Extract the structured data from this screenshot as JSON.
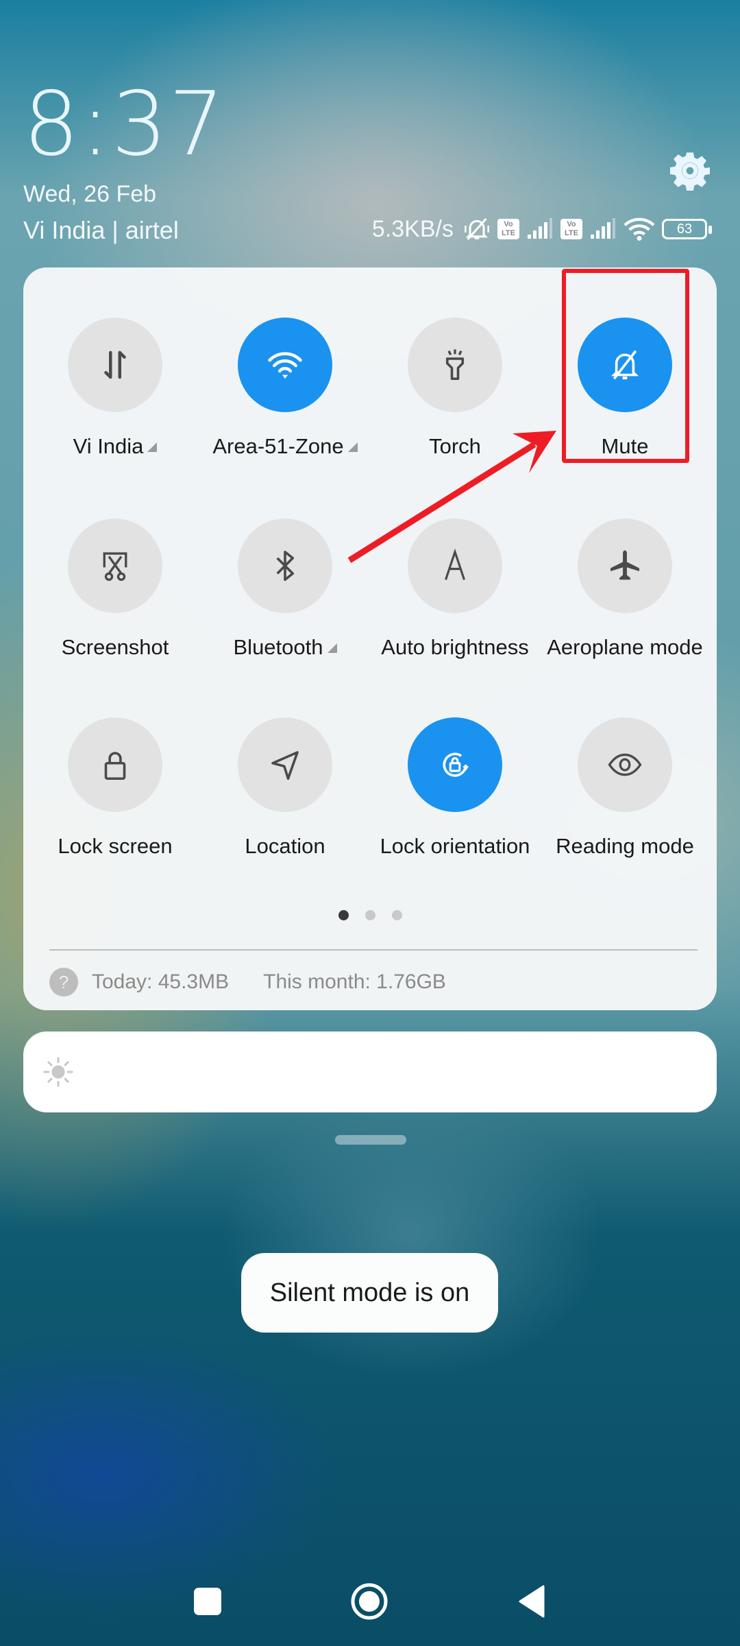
{
  "header": {
    "time": "8:37",
    "date": "Wed, 26 Feb",
    "carrier": "Vi India | airtel",
    "settings_icon": "gear-icon"
  },
  "status_bar": {
    "network_speed": "5.3KB/s",
    "icons": [
      "mute-bell-icon",
      "volte-icon",
      "signal-icon",
      "volte-icon",
      "signal-icon",
      "wifi-icon",
      "battery-icon"
    ],
    "volte_label": "Vo LTE",
    "battery_level": "63"
  },
  "quick_settings": {
    "tiles": [
      {
        "label": "Vi India",
        "icon": "mobile-data-icon",
        "active": false,
        "has_more": true
      },
      {
        "label": "Area-51-Zone",
        "icon": "wifi-icon",
        "active": true,
        "has_more": true
      },
      {
        "label": "Torch",
        "icon": "torch-icon",
        "active": false,
        "has_more": false
      },
      {
        "label": "Mute",
        "icon": "mute-bell-icon",
        "active": true,
        "has_more": false
      },
      {
        "label": "Screenshot",
        "icon": "screenshot-icon",
        "active": false,
        "has_more": false
      },
      {
        "label": "Bluetooth",
        "icon": "bluetooth-icon",
        "active": false,
        "has_more": true
      },
      {
        "label": "Auto brightness",
        "icon": "auto-brightness-icon",
        "active": false,
        "has_more": false
      },
      {
        "label": "Aeroplane mode",
        "icon": "aeroplane-icon",
        "active": false,
        "has_more": false
      },
      {
        "label": "Lock screen",
        "icon": "lock-icon",
        "active": false,
        "has_more": false
      },
      {
        "label": "Location",
        "icon": "location-icon",
        "active": false,
        "has_more": false
      },
      {
        "label": "Lock orientation",
        "icon": "rotation-lock-icon",
        "active": true,
        "has_more": false
      },
      {
        "label": "Reading mode",
        "icon": "eye-icon",
        "active": false,
        "has_more": false
      }
    ],
    "pages": {
      "current": 1,
      "total": 3
    },
    "data_usage": {
      "today": "Today: 45.3MB",
      "month": "This month: 1.76GB",
      "help_glyph": "?"
    }
  },
  "brightness": {
    "icon": "sun-icon"
  },
  "toast": {
    "message": "Silent mode is on"
  },
  "navigation": {
    "recents": "recents-button",
    "home": "home-button",
    "back": "back-button"
  },
  "annotation": {
    "highlight_color": "#ee1c25",
    "target": "Mute"
  },
  "colors": {
    "accent": "#1a92f0",
    "tile_inactive": "#e2e2e2"
  }
}
